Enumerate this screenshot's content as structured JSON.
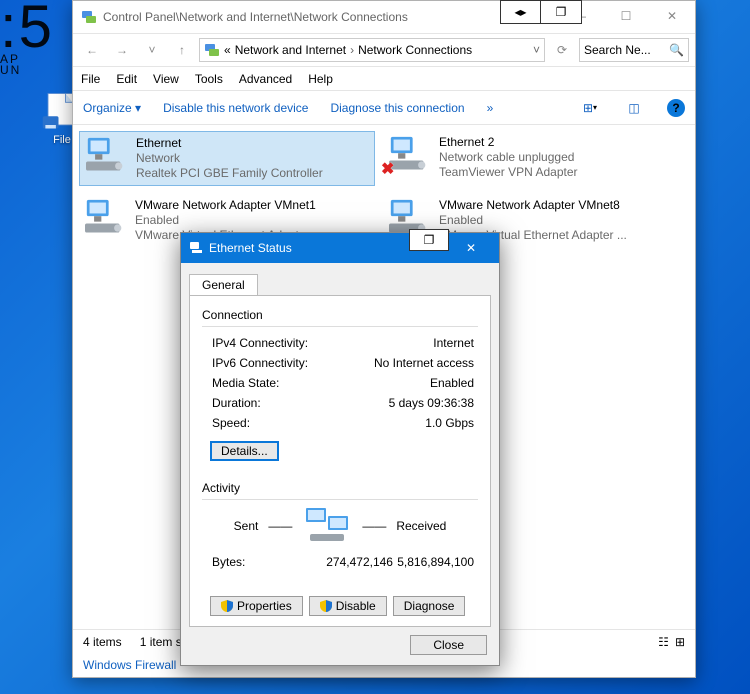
{
  "desktop": {
    "big": ":5",
    "l2": "AP",
    "l3": "UN",
    "icon_label": "File"
  },
  "window": {
    "title": "Control Panel\\Network and Internet\\Network Connections",
    "breadcrumb_pre": "«",
    "crumb1": "Network and Internet",
    "crumb2": "Network Connections",
    "search_placeholder": "Search Ne...",
    "menu": {
      "file": "File",
      "edit": "Edit",
      "view": "View",
      "tools": "Tools",
      "advanced": "Advanced",
      "help": "Help"
    },
    "cmd": {
      "organize": "Organize ▾",
      "disable": "Disable this network device",
      "diagnose": "Diagnose this connection",
      "more": "»"
    },
    "help_tip": "?",
    "adapters": [
      {
        "name": "Ethernet",
        "status": "Network",
        "desc": "Realtek PCI GBE Family Controller",
        "selected": true,
        "unplugged": false
      },
      {
        "name": "Ethernet 2",
        "status": "Network cable unplugged",
        "desc": "TeamViewer VPN Adapter",
        "selected": false,
        "unplugged": true
      },
      {
        "name": "VMware Network Adapter VMnet1",
        "status": "Enabled",
        "desc": "VMware Virtual Ethernet Adapter ...",
        "selected": false,
        "unplugged": false
      },
      {
        "name": "VMware Network Adapter VMnet8",
        "status": "Enabled",
        "desc": "VMware Virtual Ethernet Adapter ...",
        "selected": false,
        "unplugged": false
      }
    ],
    "status": {
      "count": "4 items",
      "sel": "1 item s"
    },
    "link": "Windows Firewall"
  },
  "dialog": {
    "title": "Ethernet Status",
    "tab": "General",
    "group_conn": "Connection",
    "rows": [
      {
        "k": "IPv4 Connectivity:",
        "v": "Internet"
      },
      {
        "k": "IPv6 Connectivity:",
        "v": "No Internet access"
      },
      {
        "k": "Media State:",
        "v": "Enabled"
      },
      {
        "k": "Duration:",
        "v": "5 days 09:36:38"
      },
      {
        "k": "Speed:",
        "v": "1.0 Gbps"
      }
    ],
    "details_btn": "Details...",
    "group_act": "Activity",
    "sent_lbl": "Sent",
    "recv_lbl": "Received",
    "bytes_lbl": "Bytes:",
    "bytes_sent": "274,472,146",
    "bytes_recv": "5,816,894,100",
    "properties": "Properties",
    "disable": "Disable",
    "diagnose": "Diagnose",
    "close": "Close"
  }
}
